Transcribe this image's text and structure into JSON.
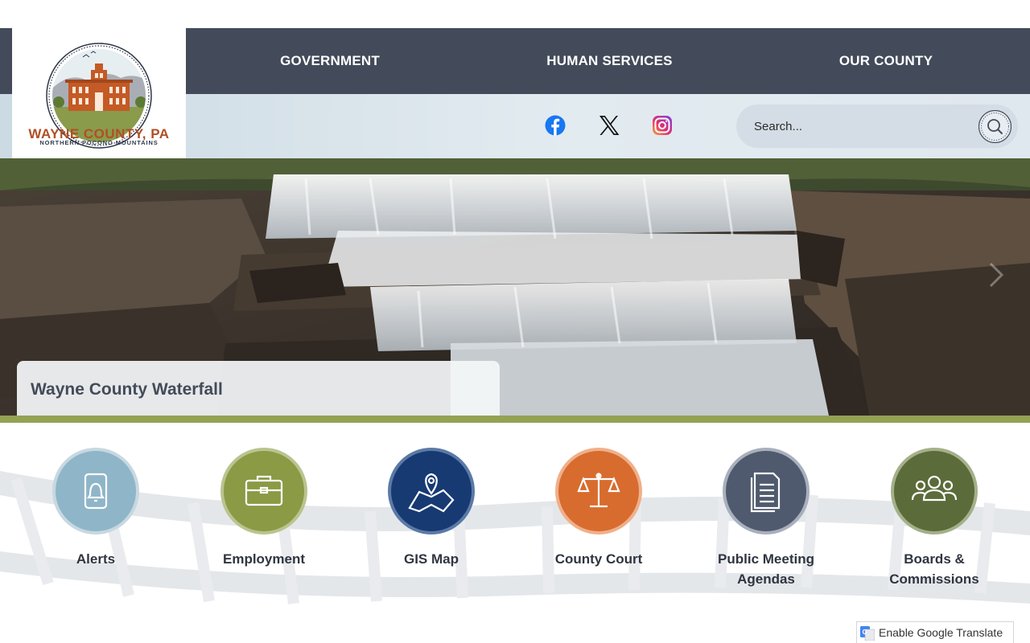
{
  "logo": {
    "title": "WAYNE COUNTY, PA",
    "subtitle": "NORTHERN POCONO MOUNTAINS"
  },
  "nav": {
    "items": [
      {
        "label": "GOVERNMENT"
      },
      {
        "label": "HUMAN SERVICES"
      },
      {
        "label": "OUR COUNTY"
      }
    ]
  },
  "social": {
    "icons": [
      "facebook-icon",
      "x-icon",
      "instagram-icon"
    ]
  },
  "search": {
    "placeholder": "Search..."
  },
  "hero": {
    "caption": "Wayne County Waterfall"
  },
  "quicklinks": [
    {
      "label": "Alerts",
      "icon": "bell-phone-icon",
      "color": "#8fb5c8"
    },
    {
      "label": "Employment",
      "icon": "briefcase-icon",
      "color": "#8a9a45"
    },
    {
      "label": "GIS Map",
      "icon": "map-pin-icon",
      "color": "#173a73"
    },
    {
      "label": "County Court",
      "icon": "scales-icon",
      "color": "#d76c2e"
    },
    {
      "label": "Public Meeting Agendas",
      "icon": "document-icon",
      "color": "#4f5a6e"
    },
    {
      "label": "Boards & Commissions",
      "icon": "group-icon",
      "color": "#5b6b39"
    }
  ],
  "translate": {
    "label": "Enable Google Translate"
  },
  "colors": {
    "nav_bg": "#434b5a",
    "accent_green": "#93a253",
    "brand_orange": "#b04f25"
  }
}
